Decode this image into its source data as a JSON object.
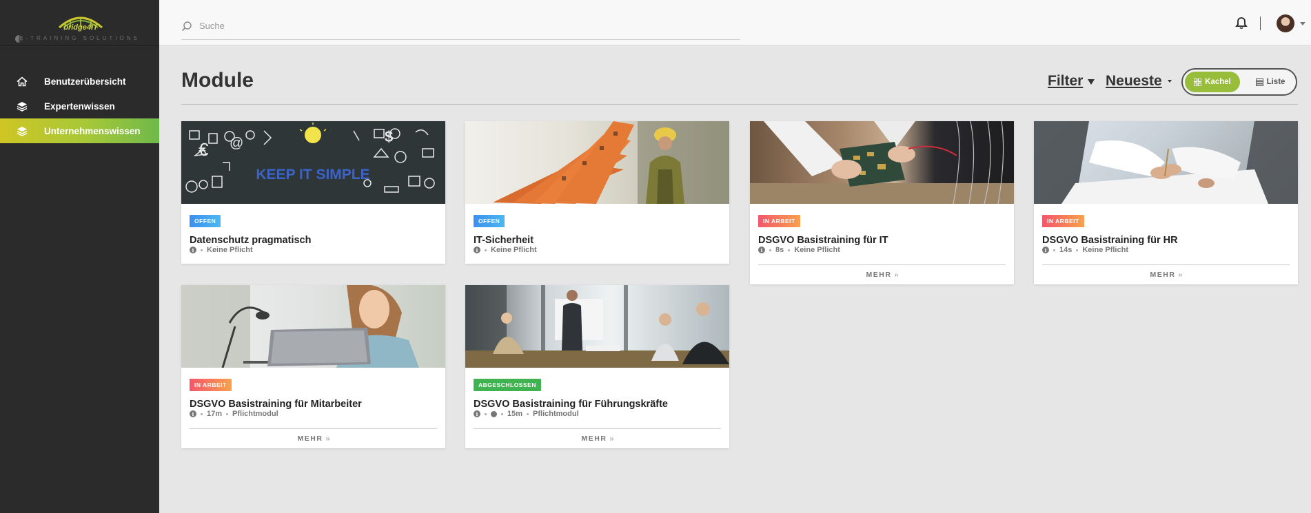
{
  "sidebar": {
    "logo": {
      "name": "bridge4IT",
      "sub": "E-TRAINING  SOLUTIONS"
    },
    "items": [
      {
        "label": "Benutzerübersicht",
        "icon": "home-icon"
      },
      {
        "label": "Expertenwissen",
        "icon": "layers-icon"
      },
      {
        "label": "Unternehmenswissen",
        "icon": "layers-icon",
        "active": true
      }
    ]
  },
  "topbar": {
    "search_placeholder": "Suche",
    "icons": [
      "search-icon",
      "bell-icon",
      "avatar",
      "chevron-down-icon"
    ]
  },
  "main": {
    "title": "Module",
    "filter_label": "Filter",
    "sort_label": "Neueste",
    "view_toggle": {
      "tile_label": "Kachel",
      "list_label": "Liste",
      "selected": "Kachel"
    }
  },
  "colors": {
    "sidebar_bg": "#2b2b2b",
    "accent_green": "#97bd3a",
    "badge_open": "#3d8ff0",
    "badge_in_progress": "#f4566b",
    "badge_done": "#3fb34f"
  },
  "cards": [
    {
      "image": "keep-it-simple-chalkboard",
      "image_text": "KEEP IT SIMPLE",
      "status": "OFFEN",
      "title": "Datenschutz pragmatisch",
      "meta": [
        "Keine Pflicht"
      ],
      "more": ""
    },
    {
      "image": "network-switch-worker",
      "status": "OFFEN",
      "title": "IT-Sicherheit",
      "meta": [
        "Keine Pflicht"
      ],
      "more": ""
    },
    {
      "image": "hard-drive-hands",
      "status": "IN ARBEIT",
      "title": "DSGVO Basistraining für IT",
      "meta": [
        "8s",
        "Keine Pflicht"
      ],
      "more": "MEHR"
    },
    {
      "image": "meeting-hands-documents",
      "status": "IN ARBEIT",
      "title": "DSGVO Basistraining für HR",
      "meta": [
        "14s",
        "Keine Pflicht"
      ],
      "more": "MEHR"
    },
    {
      "image": "woman-laptop",
      "status": "IN ARBEIT",
      "title": "DSGVO Basistraining für Mitarbeiter",
      "meta": [
        "17m",
        "Pflichtmodul"
      ],
      "more": "MEHR"
    },
    {
      "image": "business-presentation",
      "status": "ABGESCHLOSSEN",
      "title": "DSGVO Basistraining für Führungskräfte",
      "meta": [
        "15m",
        "Pflichtmodul"
      ],
      "more": "MEHR"
    }
  ]
}
